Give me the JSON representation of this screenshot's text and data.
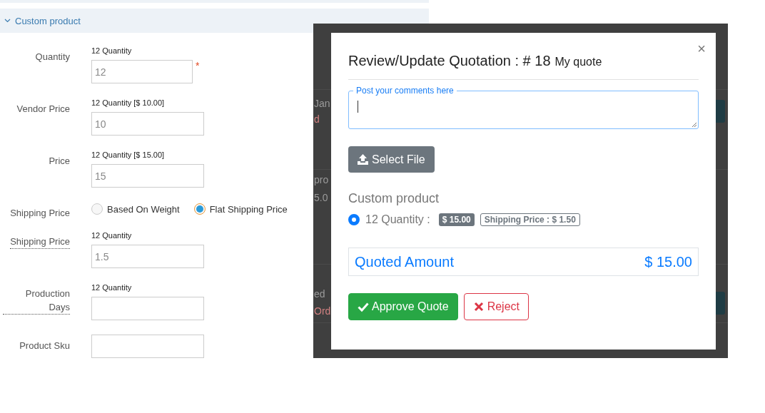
{
  "form_panel": {
    "section": {
      "title": "Custom product",
      "expanded": true
    },
    "required_mark": "*",
    "fields": [
      {
        "kind": "input",
        "label": "Quantity",
        "caption": "12 Quantity",
        "value": "12",
        "required": true,
        "hint": false
      },
      {
        "kind": "input",
        "label": "Vendor Price",
        "caption": "12 Quantity [$ 10.00]",
        "value": "10",
        "required": false,
        "hint": false
      },
      {
        "kind": "input",
        "label": "Price",
        "caption": "12 Quantity [$ 15.00]",
        "value": "15",
        "required": false,
        "hint": false
      },
      {
        "kind": "radio",
        "label": "Shipping Price",
        "hint": false,
        "options": [
          {
            "label": "Based On Weight",
            "selected": false
          },
          {
            "label": "Flat Shipping Price",
            "selected": true
          }
        ]
      },
      {
        "kind": "input",
        "label": "Shipping Price",
        "caption": "12 Quantity",
        "value": "1.5",
        "required": false,
        "hint": true
      },
      {
        "kind": "input",
        "label": "Production Days",
        "caption": "12 Quantity",
        "required": false,
        "hint": true
      },
      {
        "kind": "input",
        "label": "Product Sku",
        "required": false,
        "hint": false
      }
    ]
  },
  "background_page": {
    "fragments": [
      {
        "kind": "plain",
        "text": "Jan"
      },
      {
        "kind": "alert",
        "text": "d"
      },
      {
        "kind": "plain",
        "text": "pro"
      },
      {
        "kind": "plain",
        "text": "5.0"
      },
      {
        "kind": "plain",
        "text": "ed"
      },
      {
        "kind": "alert",
        "text": "Ord"
      }
    ]
  },
  "modal": {
    "title": "Review/Update Quotation : # 18",
    "subtitle": "My quote",
    "close": "×",
    "comment": {
      "label": "Post your comments here",
      "focused": true
    },
    "file_button": "Select File",
    "product": {
      "name": "Custom product",
      "option": {
        "label": "12 Quantity :",
        "selected": true,
        "price": "$ 15.00",
        "shipping": "Shipping Price : $ 1.50"
      }
    },
    "quoted": {
      "label": "Quoted Amount",
      "amount": "$ 15.00"
    },
    "buttons": [
      {
        "kind": "approve",
        "label": "Approve Quote"
      },
      {
        "kind": "reject",
        "label": "Reject"
      }
    ]
  }
}
